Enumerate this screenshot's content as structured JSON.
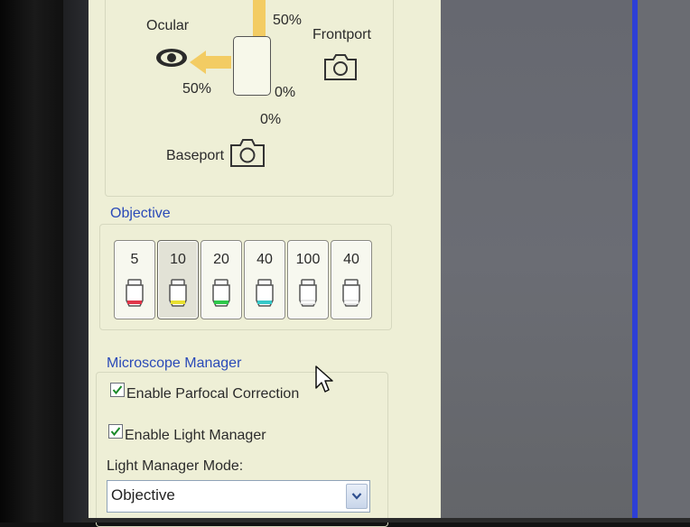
{
  "light_path": {
    "top_percent": "50%",
    "ocular_label": "Ocular",
    "ocular_percent": "50%",
    "frontport_label": "Frontport",
    "frontport_percent": "0%",
    "baseport_percent": "0%",
    "baseport_label": "Baseport",
    "arrow_color": "#f3cc63"
  },
  "objective": {
    "title": "Objective",
    "buttons": [
      {
        "label": "5",
        "color": "#e0364a",
        "icon": "objective-lens-icon"
      },
      {
        "label": "10",
        "color": "#e8e030",
        "icon": "objective-lens-icon",
        "selected": true
      },
      {
        "label": "20",
        "color": "#2ec84a",
        "icon": "objective-lens-icon"
      },
      {
        "label": "40",
        "color": "#36c8c8",
        "icon": "objective-lens-icon"
      },
      {
        "label": "100",
        "color": "#ffffff",
        "icon": "objective-lens-icon"
      },
      {
        "label": "40",
        "color": "#ffffff",
        "icon": "objective-lens-icon"
      }
    ]
  },
  "microscope_manager": {
    "title": "Microscope Manager",
    "parfocal_label": "Enable Parfocal Correction",
    "parfocal_checked": true,
    "light_manager_label": "Enable Light Manager",
    "light_manager_checked": true,
    "mode_label": "Light Manager Mode:",
    "mode_value": "Objective"
  },
  "colors": {
    "panel_bg": "#eeefd6",
    "section_title": "#2a4ab8",
    "accent_blue_line": "#2d3fd6"
  }
}
